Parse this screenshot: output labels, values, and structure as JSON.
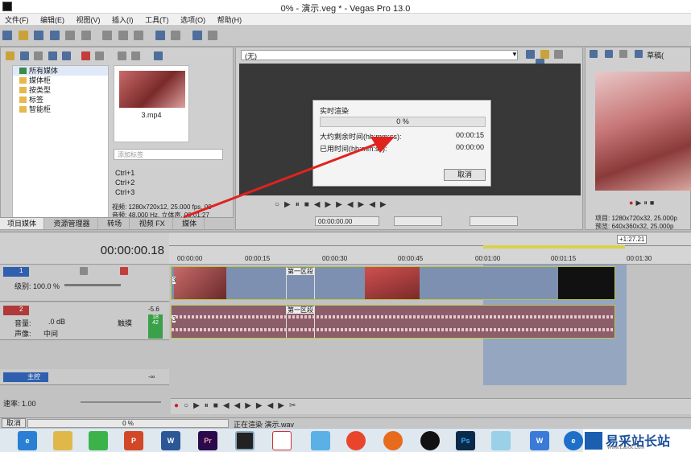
{
  "window": {
    "title": "0% - 演示.veg * - Vegas Pro 13.0"
  },
  "menu": [
    "文件(F)",
    "编辑(E)",
    "视图(V)",
    "插入(I)",
    "工具(T)",
    "选项(O)",
    "帮助(H)"
  ],
  "explorer": {
    "tree": [
      "所有媒体",
      "媒体柜",
      "按类型",
      "标签",
      "智能柜"
    ],
    "thumb_label": "3.mp4",
    "tag_placeholder": "添加标签",
    "shortcuts": [
      "Ctrl+1",
      "Ctrl+2",
      "Ctrl+3"
    ],
    "video_info": "视频: 1280x720x12, 25.000 fps, 00",
    "audio_info": "音频: 48,000 Hz, 立体声, 00:01:27",
    "tabs": [
      "项目媒体",
      "资源管理器",
      "转场",
      "视频 FX",
      "媒体"
    ]
  },
  "trimmer": {
    "dropdown": "(无)",
    "time": "00:00:00.00"
  },
  "preview": {
    "label": "草稿(",
    "project_info": "项目: 1280x720x32, 25.000p",
    "preview_info": "预览: 640x360x32, 25.000p"
  },
  "dialog": {
    "title": "实时渲染",
    "progress": "0 %",
    "progress_value": 0,
    "remaining_label": "大约剩余时间(hh:mm:ss):",
    "remaining_value": "00:00:15",
    "elapsed_label": "已用时间(hh:mm:ss):",
    "elapsed_value": "00:00:00",
    "cancel": "取消"
  },
  "timeline": {
    "current_time": "00:00:00.18",
    "end_marker": "+1:27.21",
    "ruler": [
      "00:00:00",
      "00:00:15",
      "00:00:30",
      "00:00:45",
      "00:01:00",
      "00:01:15",
      "00:01:30"
    ],
    "video_track": {
      "number": "1",
      "level": "级别: 100.0 %",
      "clip_label": "第一区段",
      "clip_num": "3"
    },
    "audio_track": {
      "number": "2",
      "db": "-5.6",
      "volume_label": "音量:",
      "volume": ".0 dB",
      "pan_label": "声像:",
      "pan": "中间",
      "mode": "触摸",
      "clip_label": "第一区段",
      "meter_a": "18",
      "meter_b": "42",
      "clip_num": "3"
    },
    "master": {
      "label": "主控",
      "level": "-∞"
    },
    "rate": "速率: 1.00"
  },
  "status": {
    "cancel": "取消",
    "progress": "0 %",
    "message": "正在渲染 演示.wav"
  },
  "taskbar": {
    "icons": [
      "ie-icon",
      "explorer-icon",
      "wechat-icon",
      "powerpoint-icon",
      "word-icon",
      "premiere-icon",
      "vegas-icon",
      "wps-pdf-icon",
      "qq-bird-icon",
      "chrome-icon",
      "firefox-icon",
      "qq-icon",
      "photoshop-icon",
      "notes-icon",
      "wps-icon",
      "edge-icon"
    ],
    "brand": "易采站长站",
    "brand_sub": "Www.Easck.Com"
  },
  "colors": {
    "accent": "#2a6fd6",
    "clip_video": "#7d90b2",
    "clip_audio": "#8c5e6a",
    "selection": "#6f8fbf",
    "arrow": "#e0231d"
  }
}
